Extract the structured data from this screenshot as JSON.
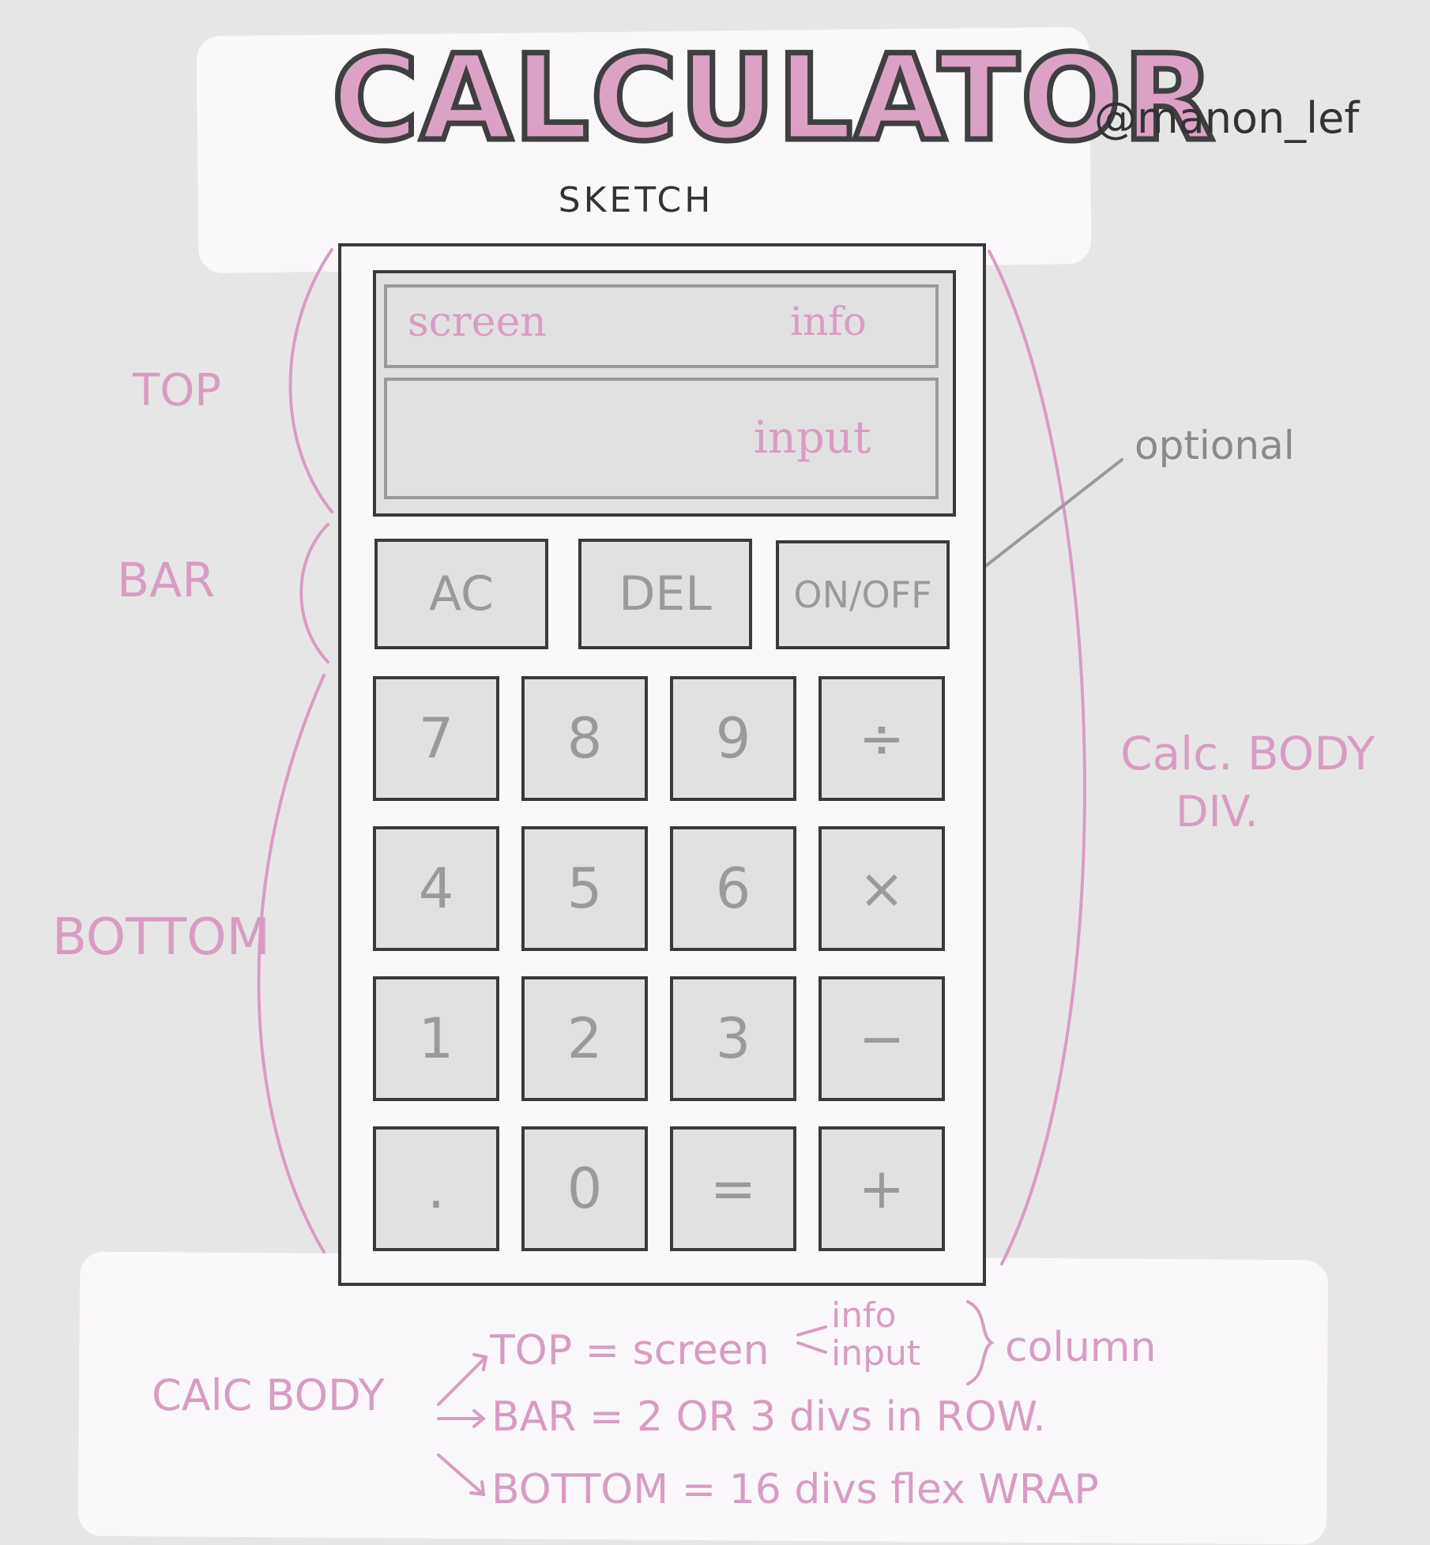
{
  "title": "CALCULATOR",
  "subtitle": "SKETCH",
  "handle": "@manon_lef",
  "screen": {
    "info_label": "info",
    "screen_label": "screen",
    "input_label": "input"
  },
  "bar_keys": [
    "AC",
    "DEL",
    "ON/OFF"
  ],
  "number_keys": [
    "7",
    "8",
    "9",
    "÷",
    "4",
    "5",
    "6",
    "×",
    "1",
    "2",
    "3",
    "−",
    ".",
    "0",
    "=",
    "+"
  ],
  "annotations": {
    "top": "TOP",
    "bar": "BAR",
    "bottom": "BOTTOM",
    "optional": "optional",
    "calc_body_div_line1": "Calc. BODY",
    "calc_body_div_line2": "DIV."
  },
  "notes": {
    "calc_body": "CAlC BODY",
    "top_line": "TOP = screen",
    "top_info": "info",
    "top_input": "input",
    "top_column": "column",
    "bar_line": "BAR = 2 OR 3 divs in ROW.",
    "bottom_line": "BOTTOM = 16 divs flex WRAP"
  },
  "colors": {
    "pink": "#d89cc3",
    "title_fill": "#dba2c6",
    "outline": "#3a3a3a",
    "key_gray": "#e1e1e1",
    "key_text": "#9a9a9a"
  }
}
